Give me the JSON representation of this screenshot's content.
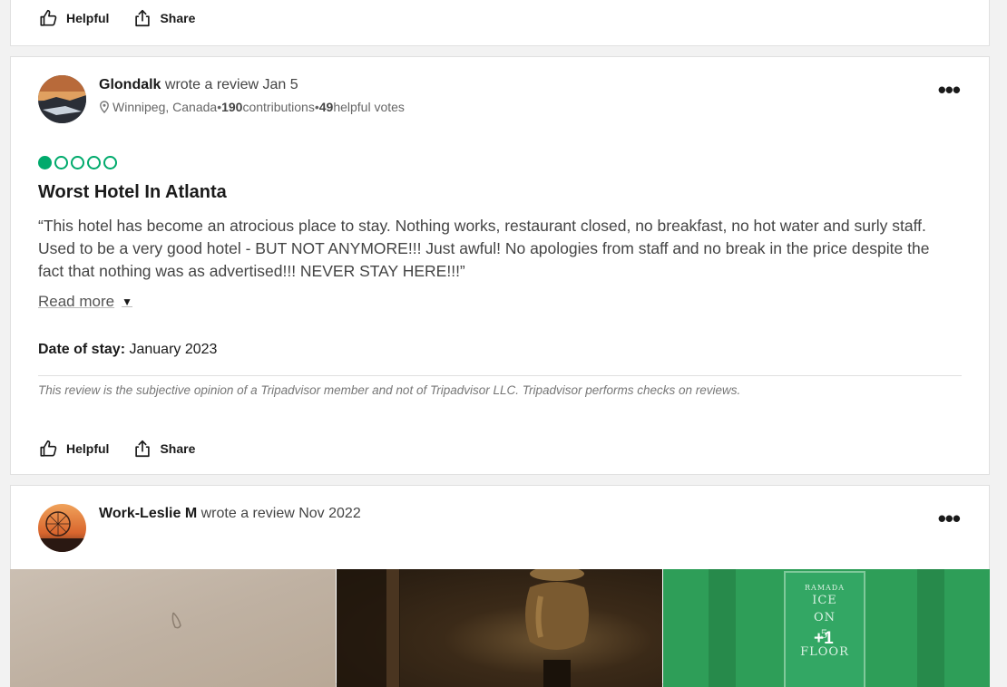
{
  "top_actions": {
    "helpful_label": "Helpful",
    "share_label": "Share"
  },
  "review1": {
    "author": "Glondalk",
    "wrote_text": " wrote a review ",
    "date": "Jan 5",
    "location": "Winnipeg, Canada",
    "contributions_count": "190",
    "contributions_label": " contributions",
    "helpful_votes_count": "49",
    "helpful_votes_label": " helpful votes",
    "separator": " • ",
    "rating": 1,
    "rating_max": 5,
    "title": "Worst Hotel In Atlanta",
    "body": "“This hotel has become an atrocious place to stay. Nothing works, restaurant closed, no breakfast, no hot water and surly staff. Used to be a very good hotel - BUT NOT ANYMORE!!! Just awful! No apologies from staff and no break in the price despite the fact that nothing was as advertised!!! NEVER STAY HERE!!!”",
    "read_more": "Read more",
    "date_of_stay_label": "Date of stay:",
    "date_of_stay": " January 2023",
    "disclaimer": "This review is the subjective opinion of a Tripadvisor member and not of Tripadvisor LLC. Tripadvisor performs checks on reviews.",
    "helpful_label": "Helpful",
    "share_label": "Share",
    "more_icon": "more-options-icon"
  },
  "review2": {
    "author": "Work-Leslie M",
    "wrote_text": " wrote a review ",
    "date": "Nov 2022",
    "photo_sign": {
      "brand": "RAMADA",
      "lines": [
        "ICE",
        "ON",
        "5",
        "FLOOR"
      ]
    },
    "more_photos": "+1",
    "more_icon": "more-options-icon"
  },
  "colors": {
    "rating_green": "#00aa6c",
    "text_dark": "#1a1a1a",
    "background": "#f2f2f2"
  }
}
